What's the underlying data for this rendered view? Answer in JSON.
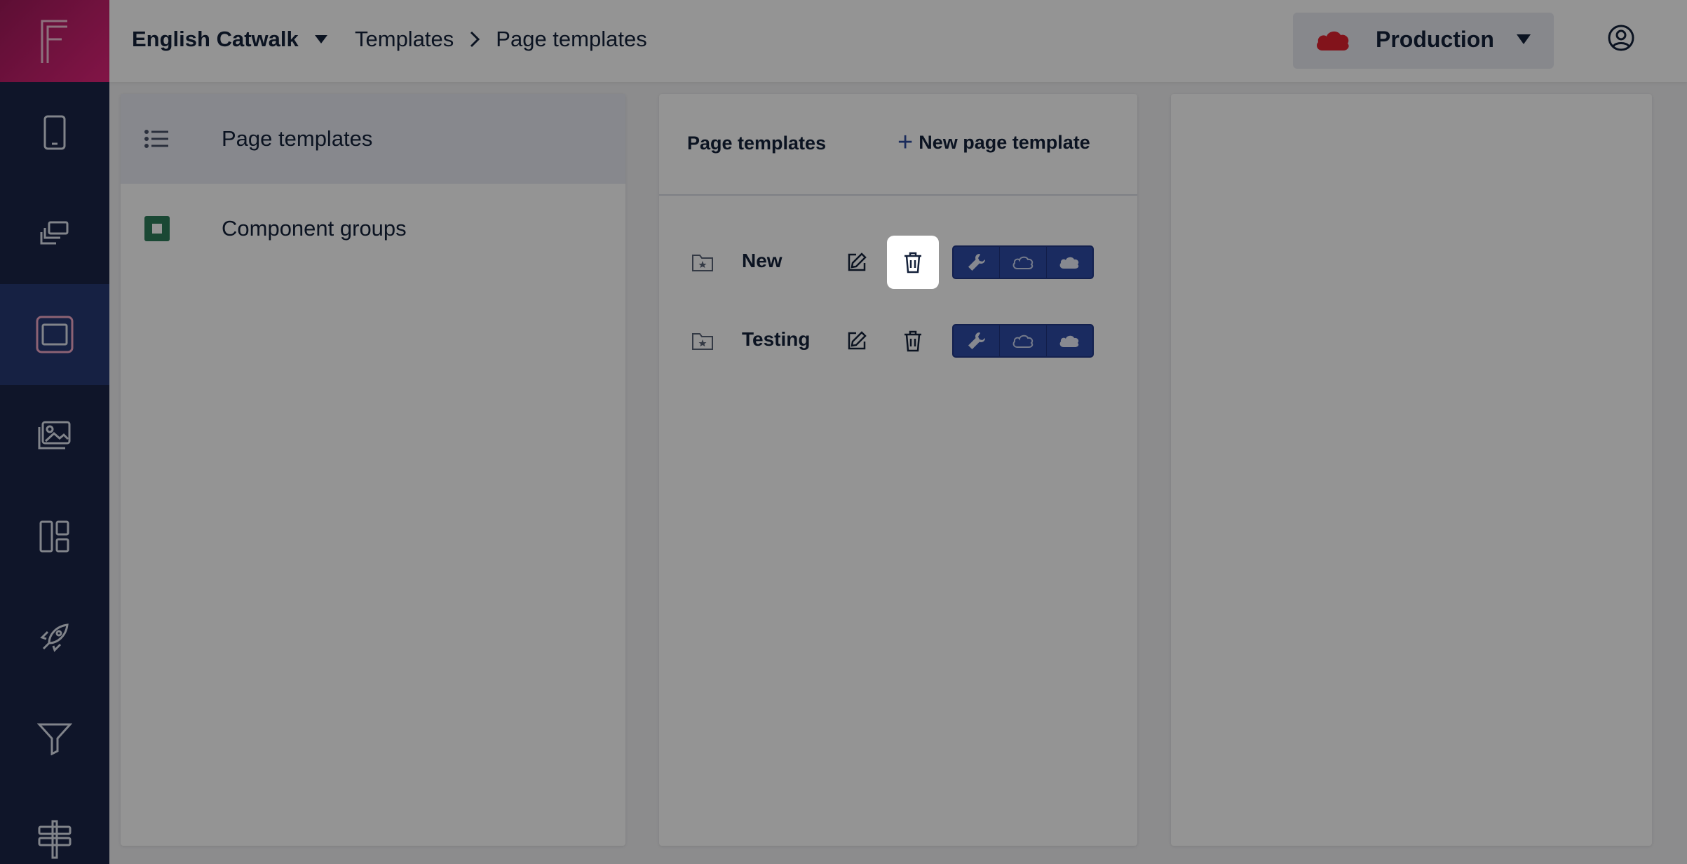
{
  "header": {
    "project": "English Catwalk",
    "breadcrumbs": [
      "Templates",
      "Page templates"
    ],
    "environment": "Production",
    "environment_color": "#e0222f"
  },
  "rail": {
    "items": [
      {
        "icon": "mobile-icon"
      },
      {
        "icon": "layers-icon"
      },
      {
        "icon": "browser-window-icon",
        "active": true
      },
      {
        "icon": "images-icon"
      },
      {
        "icon": "dashboard-layout-icon"
      },
      {
        "icon": "rocket-icon"
      },
      {
        "icon": "filter-icon"
      },
      {
        "icon": "signpost-icon"
      }
    ]
  },
  "menu": {
    "items": [
      {
        "label": "Page templates",
        "icon": "list-icon",
        "selected": true
      },
      {
        "label": "Component groups",
        "icon": "square-icon",
        "color": "#2e7d5b"
      }
    ]
  },
  "templates_panel": {
    "title": "Page templates",
    "new_button": "New page template",
    "rows": [
      {
        "name": "New",
        "focused_delete": true
      },
      {
        "name": "Testing",
        "focused_delete": false
      }
    ]
  },
  "colors": {
    "rail": "#1a2548",
    "brand_start": "#a0195a",
    "brand_end": "#e0247a",
    "accent": "#2e4aa5"
  }
}
